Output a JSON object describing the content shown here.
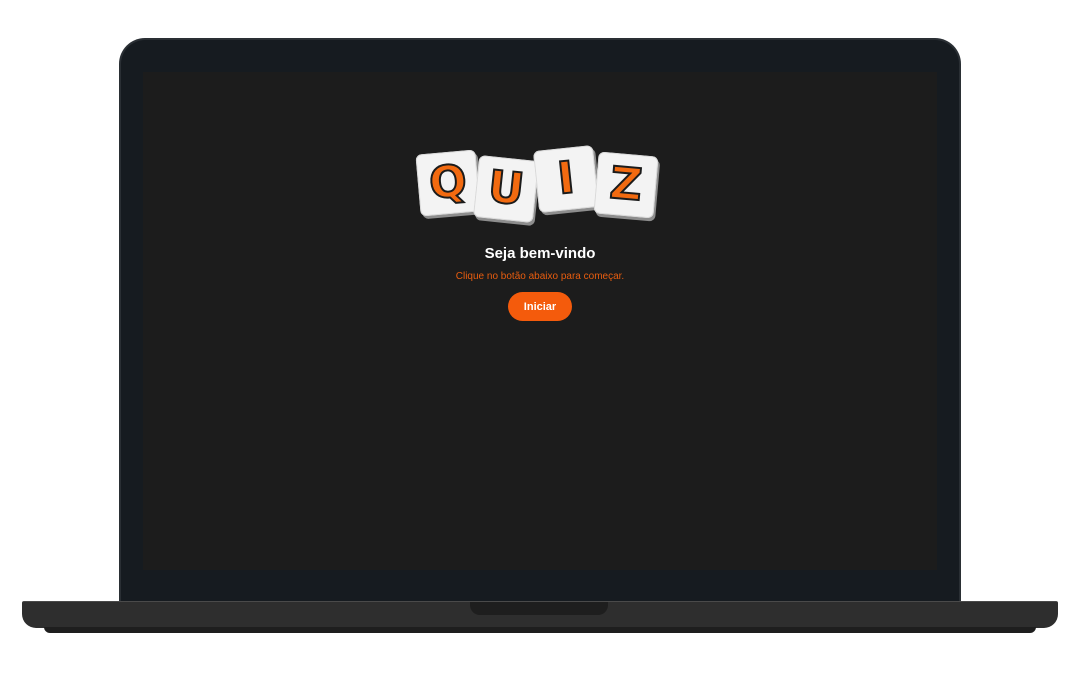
{
  "logo": {
    "letters": [
      "Q",
      "U",
      "I",
      "Z"
    ],
    "letter_color": "#f26a10",
    "tile_color": "#f3f3f3"
  },
  "welcome": {
    "title": "Seja bem-vindo",
    "subtitle": "Clique no botão abaixo para começar.",
    "start_button_label": "Iniciar"
  },
  "colors": {
    "accent": "#f45b0c",
    "screen_background": "#1c1c1c",
    "laptop_frame": "#161b20"
  }
}
